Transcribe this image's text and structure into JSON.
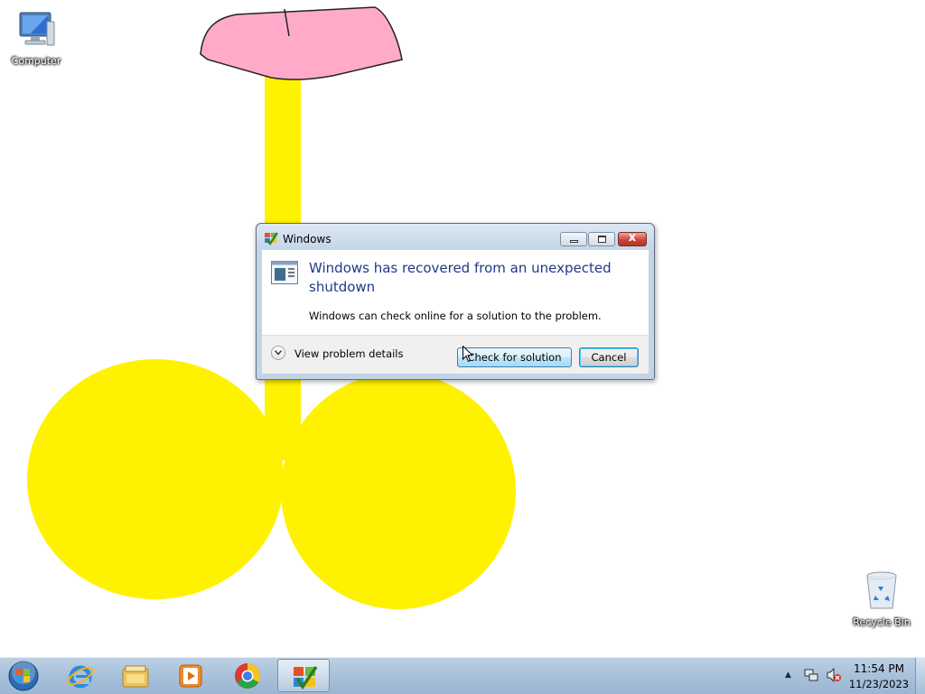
{
  "desktop": {
    "icons": [
      {
        "label": "Computer",
        "icon": "computer-icon"
      },
      {
        "label": "Recycle Bin",
        "icon": "recycle-bin-icon"
      }
    ],
    "wallpaper_colors": {
      "yellow": "#fff200",
      "pink": "#ffaac9"
    }
  },
  "dialog": {
    "title": "Windows",
    "heading": "Windows has recovered from an unexpected shutdown",
    "message": "Windows can check online for a solution to the problem.",
    "details_label": "View problem details",
    "primary_button": "Check for solution",
    "cancel_button": "Cancel",
    "close_glyph": "x"
  },
  "taskbar": {
    "pinned": [
      {
        "name": "internet-explorer-icon"
      },
      {
        "name": "windows-explorer-icon"
      },
      {
        "name": "media-player-icon"
      },
      {
        "name": "chrome-icon"
      },
      {
        "name": "action-center-app-icon",
        "active": true
      }
    ],
    "tray": {
      "show_hidden": "▲"
    },
    "clock": {
      "time": "11:54 PM",
      "date": "11/23/2023"
    }
  },
  "colors": {
    "taskbar": "#a8c0da",
    "dialog_heading": "#1e3a8a",
    "close_button": "#c8473a"
  }
}
